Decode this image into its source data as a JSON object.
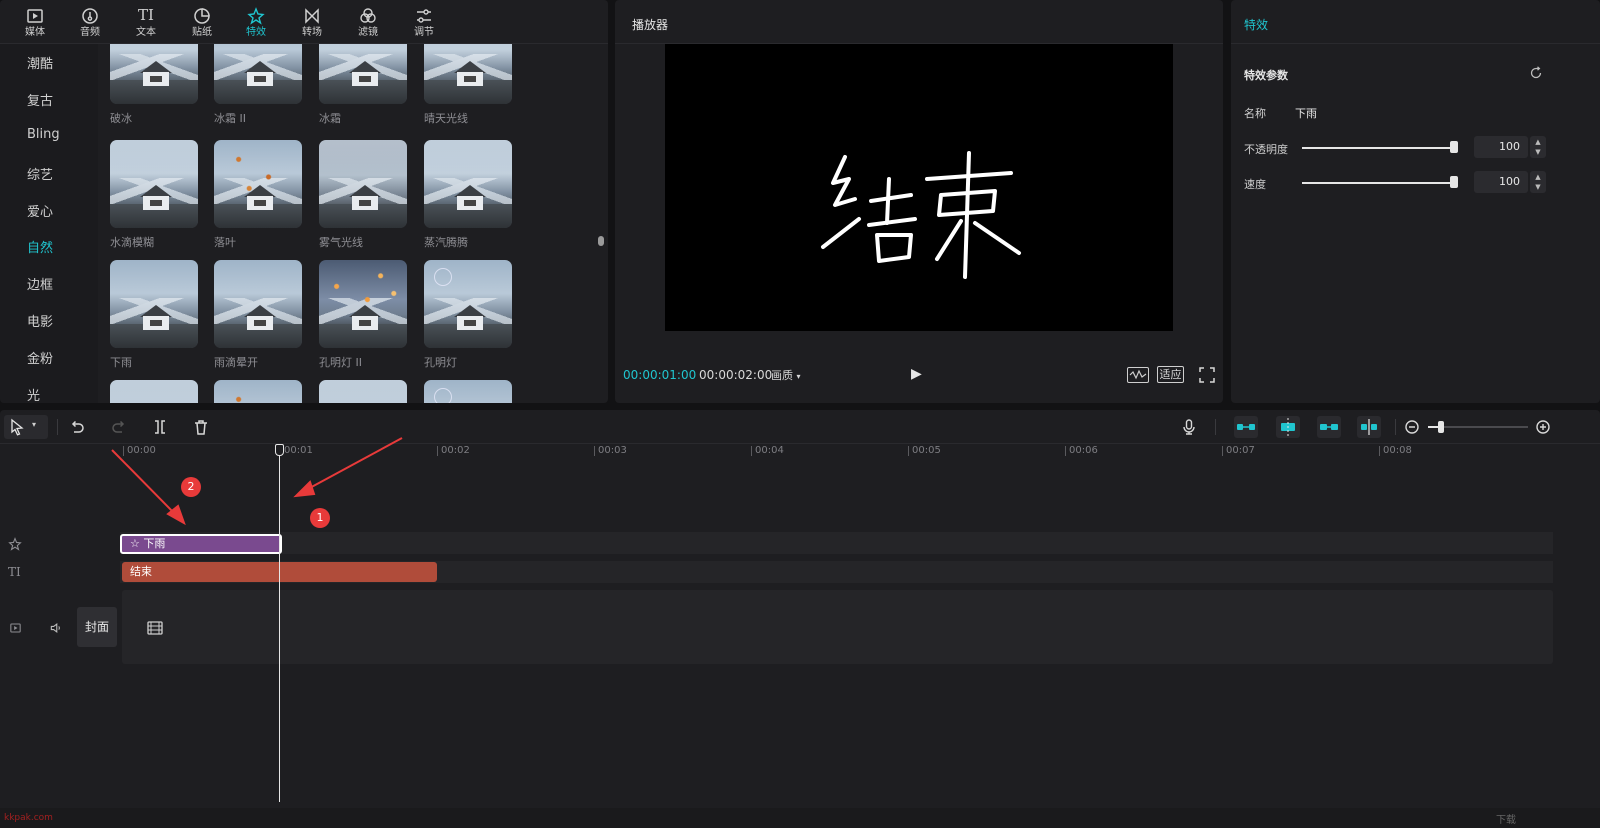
{
  "toptabs": [
    {
      "label": "媒体",
      "icon": "media-icon"
    },
    {
      "label": "音频",
      "icon": "audio-icon"
    },
    {
      "label": "文本",
      "icon": "text-icon"
    },
    {
      "label": "贴纸",
      "icon": "sticker-icon"
    },
    {
      "label": "特效",
      "icon": "effects-icon",
      "active": true
    },
    {
      "label": "转场",
      "icon": "transition-icon"
    },
    {
      "label": "滤镜",
      "icon": "filter-icon"
    },
    {
      "label": "调节",
      "icon": "adjust-icon"
    }
  ],
  "categories": [
    "潮酷",
    "复古",
    "Bling",
    "综艺",
    "爱心",
    "自然",
    "边框",
    "电影",
    "金粉",
    "光"
  ],
  "active_category": "自然",
  "effects": [
    [
      "破冰",
      "冰霜 II",
      "冰霜",
      "晴天光线"
    ],
    [
      "水滴模糊",
      "落叶",
      "雾气光线",
      "蒸汽腾腾"
    ],
    [
      "下雨",
      "雨滴晕开",
      "孔明灯 II",
      "孔明灯"
    ]
  ],
  "player": {
    "title": "播放器",
    "screen_text": "结束",
    "current_time": "00:00:01:00",
    "total_time": "00:00:02:00",
    "quality": "画质",
    "fit_label": "适应"
  },
  "effects_panel": {
    "title": "特效",
    "section": "特效参数",
    "name_label": "名称",
    "name_value": "下雨",
    "opacity_label": "不透明度",
    "opacity_value": "100",
    "speed_label": "速度",
    "speed_value": "100"
  },
  "timeline": {
    "ruler": [
      "00:00",
      "00:01",
      "00:02",
      "00:03",
      "00:04",
      "00:05",
      "00:06",
      "00:07",
      "00:08"
    ],
    "fx_clip": "下雨",
    "text_clip": "结束",
    "cover_label": "封面",
    "badges": [
      "1",
      "2"
    ]
  },
  "watermark": {
    "left": "kkpak.com",
    "right": "下载"
  },
  "colors": {
    "accent": "#20c5cf",
    "fx_clip": "#7a4a8f",
    "text_clip": "#b04c3a",
    "annotation": "#e83a3a"
  }
}
